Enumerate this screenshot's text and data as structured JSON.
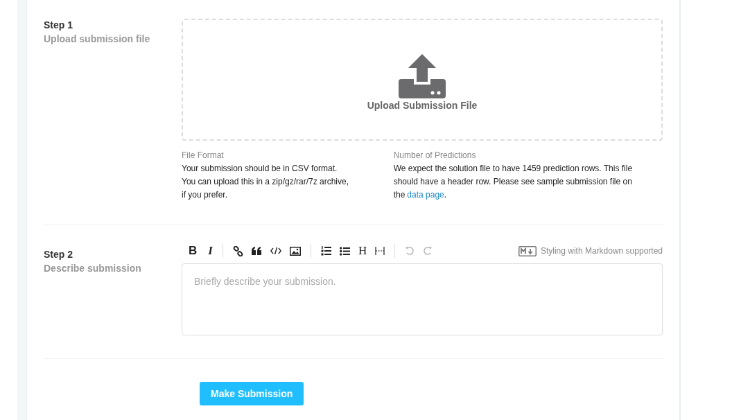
{
  "step1": {
    "title": "Step 1",
    "subtitle": "Upload submission file",
    "upload_label": "Upload Submission File",
    "info": [
      {
        "heading": "File Format",
        "text": "Your submission should be in CSV format. You can upload this in a zip/gz/rar/7z archive, if you prefer."
      },
      {
        "heading": "Number of Predictions",
        "text": "We expect the solution file to have 1459 prediction rows. This file should have a header row. Please see sample submission file on the",
        "link": "data page",
        "after": "."
      }
    ]
  },
  "step2": {
    "title": "Step 2",
    "subtitle": "Describe submission",
    "toolbar": [
      {
        "kind": "bold",
        "label": "B",
        "disabled": false
      },
      {
        "kind": "italic",
        "label": "I",
        "disabled": false
      },
      {
        "kind": "sep"
      },
      {
        "kind": "link",
        "disabled": false
      },
      {
        "kind": "quote",
        "disabled": false
      },
      {
        "kind": "code",
        "disabled": false
      },
      {
        "kind": "image",
        "disabled": false
      },
      {
        "kind": "sep"
      },
      {
        "kind": "ol",
        "disabled": false
      },
      {
        "kind": "ul",
        "disabled": false
      },
      {
        "kind": "heading",
        "label": "H",
        "disabled": false
      },
      {
        "kind": "hr",
        "disabled": false
      },
      {
        "kind": "sep"
      },
      {
        "kind": "undo",
        "disabled": true
      },
      {
        "kind": "redo",
        "disabled": true
      }
    ],
    "markdown_note": "Styling with Markdown supported",
    "placeholder": "Briefly describe your submission."
  },
  "submit_button": "Make Submission"
}
